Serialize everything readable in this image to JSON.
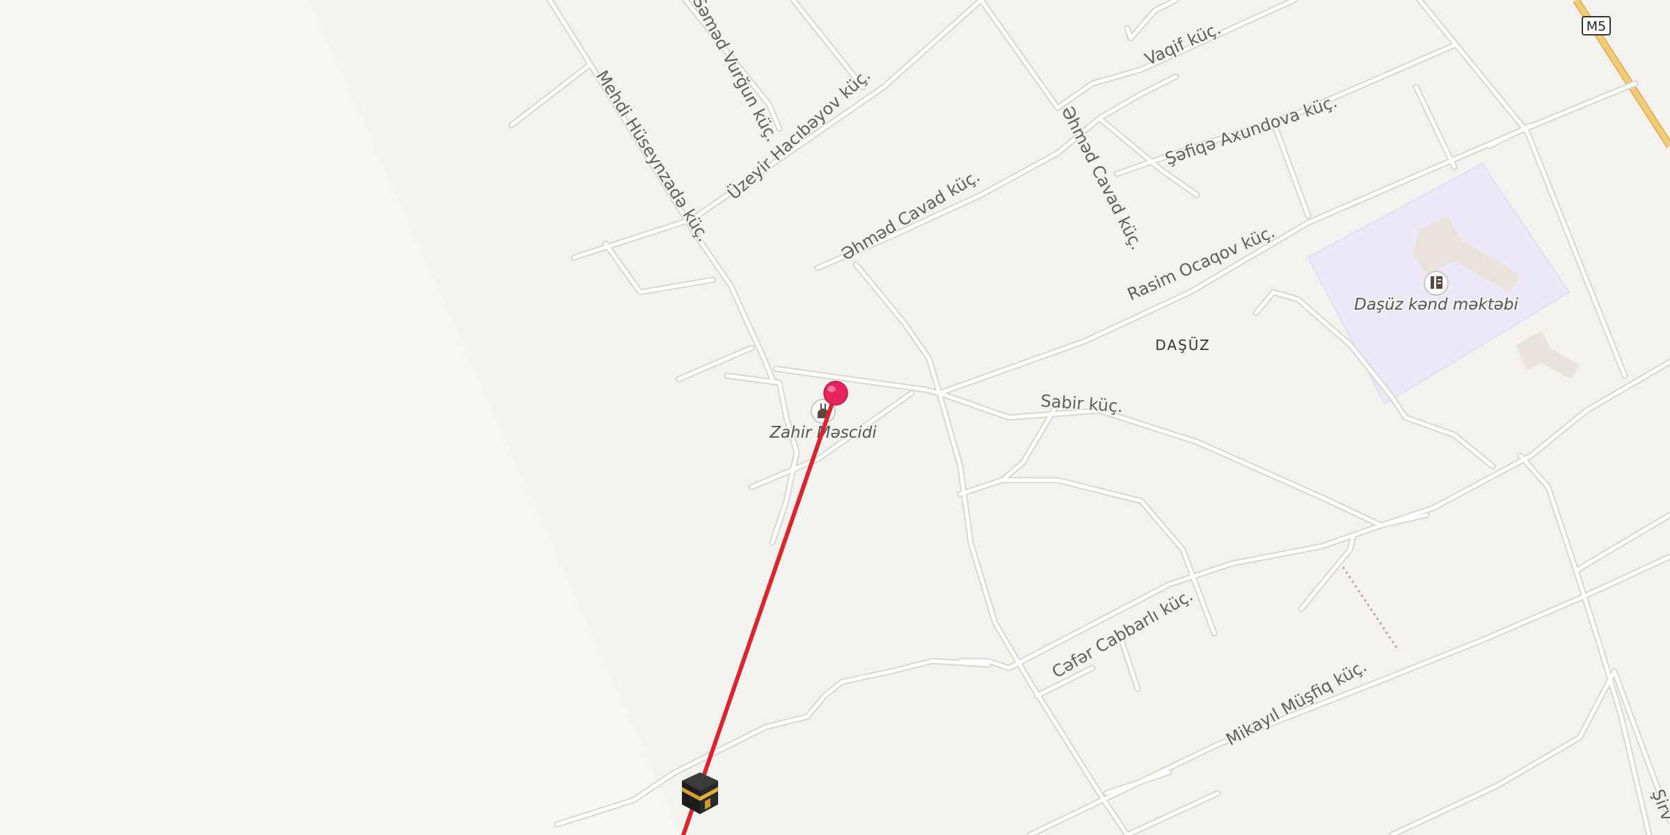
{
  "map": {
    "road_shield": "M5",
    "colors": {
      "background": "#f4f2ef",
      "sand_area": "#f8f6f3",
      "road": "#ffffff",
      "road_casing": "#d9d6d2",
      "highway": "#f2cc7a",
      "school_area": "#ece8f7",
      "building": "#e9e3dc",
      "route_line": "#d8262c",
      "pin": "#e8245e"
    },
    "streets": {
      "vurgun": "Səməd Vurğun küç.",
      "huseynzade": "Mehdi Hüseynzadə küç.",
      "haciyev": "Üzeyir Hacıbəyov küç.",
      "cavad_1": "Əhməd Cavad küç.",
      "cavad_2": "Əhməd Cavad küç.",
      "vaqif": "Vaqif küç.",
      "axundova": "Şəfiqə Axundova küç.",
      "ocaqov": "Rasim Ocaqov küç.",
      "sabir": "Sabir küç.",
      "cabbarli": "Cəfər Cabbarlı küç.",
      "musfiq": "Mikayıl Müşfiq küç.",
      "edge": "Şirv"
    },
    "places": {
      "village": "DAŞÜZ"
    },
    "pois": [
      {
        "name": "Zahir Məscidi",
        "icon": "mosque-icon"
      },
      {
        "name": "Daşüz kənd məktəbi",
        "icon": "school-icon"
      }
    ],
    "markers": {
      "location_pin": "pin-icon",
      "qibla_end": "kaaba-icon"
    }
  }
}
